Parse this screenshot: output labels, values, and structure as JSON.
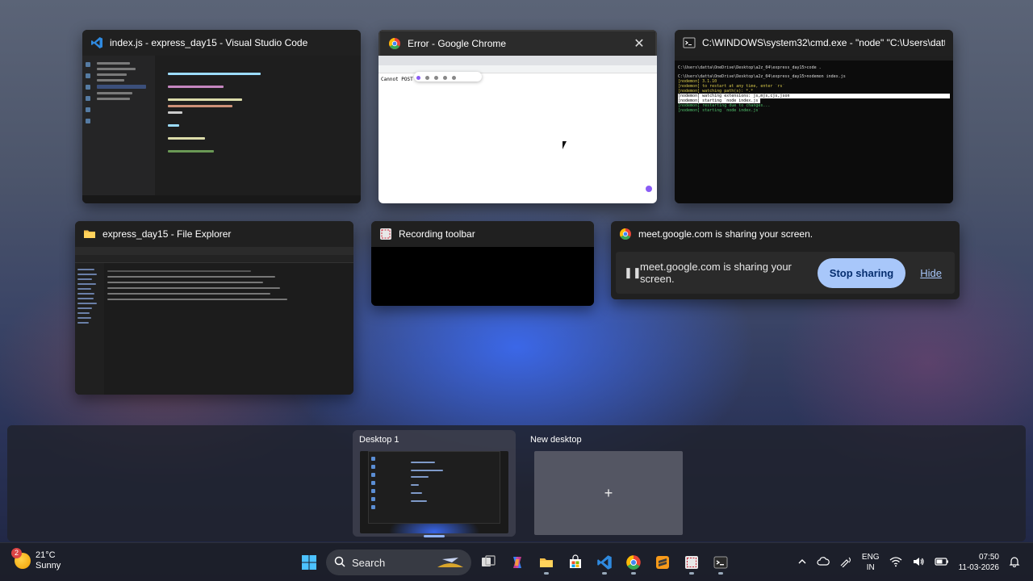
{
  "windows": {
    "vscode": {
      "title": "index.js - express_day15 - Visual Studio Code"
    },
    "chrome": {
      "title": "Error - Google Chrome",
      "page_text": "Cannot POST"
    },
    "cmd": {
      "title": "C:\\WINDOWS\\system32\\cmd.exe - \"node\"  \"C:\\Users\\datta\\AppD...",
      "lines": [
        "C:\\Users\\datta\\OneDrive\\Desktop\\a2z_04\\express_day15>code .",
        "C:\\Users\\datta\\OneDrive\\Desktop\\a2z_04\\express_day15>nodemon index.js",
        "[nodemon] 3.1.10",
        "[nodemon] to restart at any time, enter `rs`",
        "[nodemon] watching path(s): *.*",
        "[nodemon] watching extensions: js,mjs,cjs,json",
        "[nodemon] starting `node index.js`",
        "[nodemon] restarting due to changes...",
        "[nodemon] starting `node index.js`"
      ]
    },
    "explorer": {
      "title": "express_day15 - File Explorer"
    },
    "recording": {
      "title": "Recording toolbar"
    },
    "meet": {
      "title": "meet.google.com is sharing your screen.",
      "message": "meet.google.com is sharing your screen.",
      "stop_label": "Stop sharing",
      "hide_label": "Hide"
    }
  },
  "desktops": [
    {
      "label": "Desktop 1"
    },
    {
      "label": "New desktop",
      "add_symbol": "+"
    }
  ],
  "taskbar": {
    "weather": {
      "temp": "21°C",
      "condition": "Sunny",
      "badge": "2"
    },
    "search_label": "Search",
    "tray": {
      "lang_1": "ENG",
      "lang_2": "IN",
      "time": "07:50",
      "date": "11-03-2026"
    }
  },
  "colors": {
    "accent": "#a8c7fa",
    "vscode_blue": "#2f8ae0",
    "chrome_red": "#ea4335"
  }
}
